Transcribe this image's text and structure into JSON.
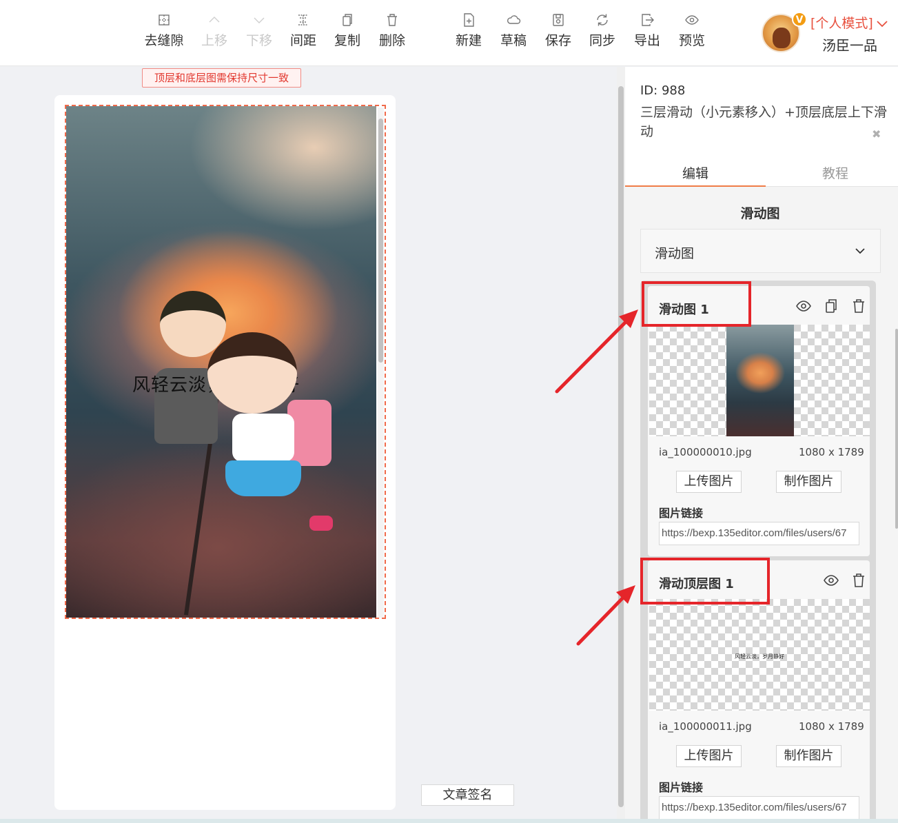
{
  "toolbar": {
    "items": [
      {
        "label": "去缝隙",
        "icon": "gap-icon"
      },
      {
        "label": "上移",
        "icon": "up-icon"
      },
      {
        "label": "下移",
        "icon": "down-icon"
      },
      {
        "label": "间距",
        "icon": "spacing-icon"
      },
      {
        "label": "复制",
        "icon": "copy-icon"
      },
      {
        "label": "删除",
        "icon": "trash-icon"
      },
      {
        "label": "新建",
        "icon": "new-file-icon"
      },
      {
        "label": "草稿",
        "icon": "cloud-icon"
      },
      {
        "label": "保存",
        "icon": "save-icon"
      },
      {
        "label": "同步",
        "icon": "sync-icon"
      },
      {
        "label": "导出",
        "icon": "export-icon"
      },
      {
        "label": "预览",
        "icon": "eye-icon"
      }
    ]
  },
  "user": {
    "mode": "[个人模式]",
    "name": "汤臣一品",
    "badge": "V",
    "badge_color": "#f39c12",
    "mode_color": "#e8513f"
  },
  "canvas": {
    "notice": "顶层和底层图需保持尺寸一致",
    "poem": "风轻云淡，岁月静好",
    "sign_button": "文章签名"
  },
  "panel": {
    "id_text": "ID: 988",
    "description": "三层滑动（小元素移入）+顶层底层上下滑动",
    "tabs": {
      "edit": "编辑",
      "tutorial": "教程"
    },
    "section_title": "滑动图",
    "dropdown_label": "滑动图",
    "cards": [
      {
        "title": "滑动图 1",
        "filename": "ia_100000010.jpg",
        "size": "1080 x 1789",
        "upload_label": "上传图片",
        "make_label": "制作图片",
        "link_label": "图片链接",
        "link_value": "https://bexp.135editor.com/files/users/67"
      },
      {
        "title": "滑动顶层图 1",
        "thumb_text": "风轻云淡，岁月静好",
        "filename": "ia_100000011.jpg",
        "size": "1080 x 1789",
        "upload_label": "上传图片",
        "make_label": "制作图片",
        "link_label": "图片链接",
        "link_value": "https://bexp.135editor.com/files/users/67"
      }
    ]
  },
  "colors": {
    "accent": "#f07c47",
    "annotation_red": "#e5252a",
    "notice_red": "#e2382f"
  }
}
